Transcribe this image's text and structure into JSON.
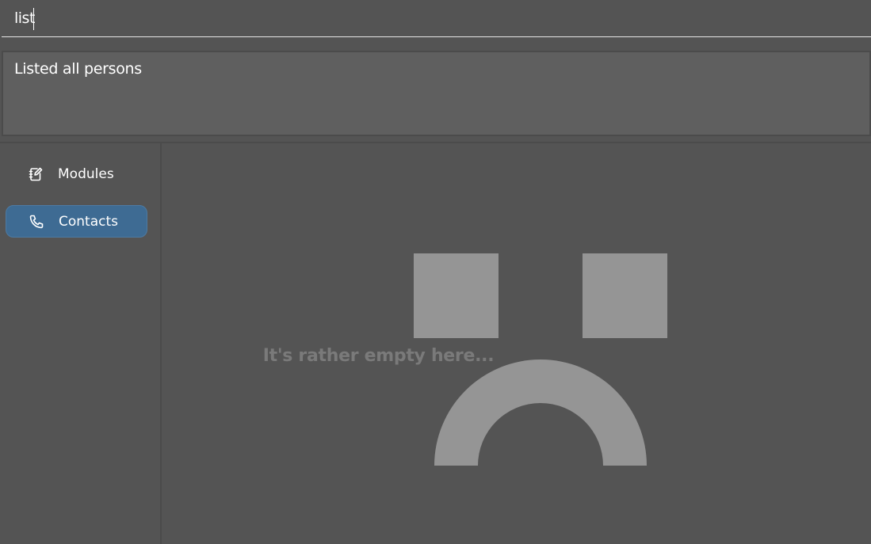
{
  "command_box": {
    "value": "list",
    "placeholder": ""
  },
  "result_display": {
    "text": "Listed all persons"
  },
  "sidebar": {
    "items": [
      {
        "label": "Modules",
        "icon": "notebook-edit-icon",
        "selected": false
      },
      {
        "label": "Contacts",
        "icon": "phone-icon",
        "selected": true
      }
    ]
  },
  "empty_state": {
    "message": "It's rather empty here..."
  },
  "colors": {
    "background": "#545454",
    "result_background": "#5f5f5f",
    "accent_selected": "#3e6b93",
    "face": "#959595",
    "empty_text": "#7a7a7a"
  }
}
